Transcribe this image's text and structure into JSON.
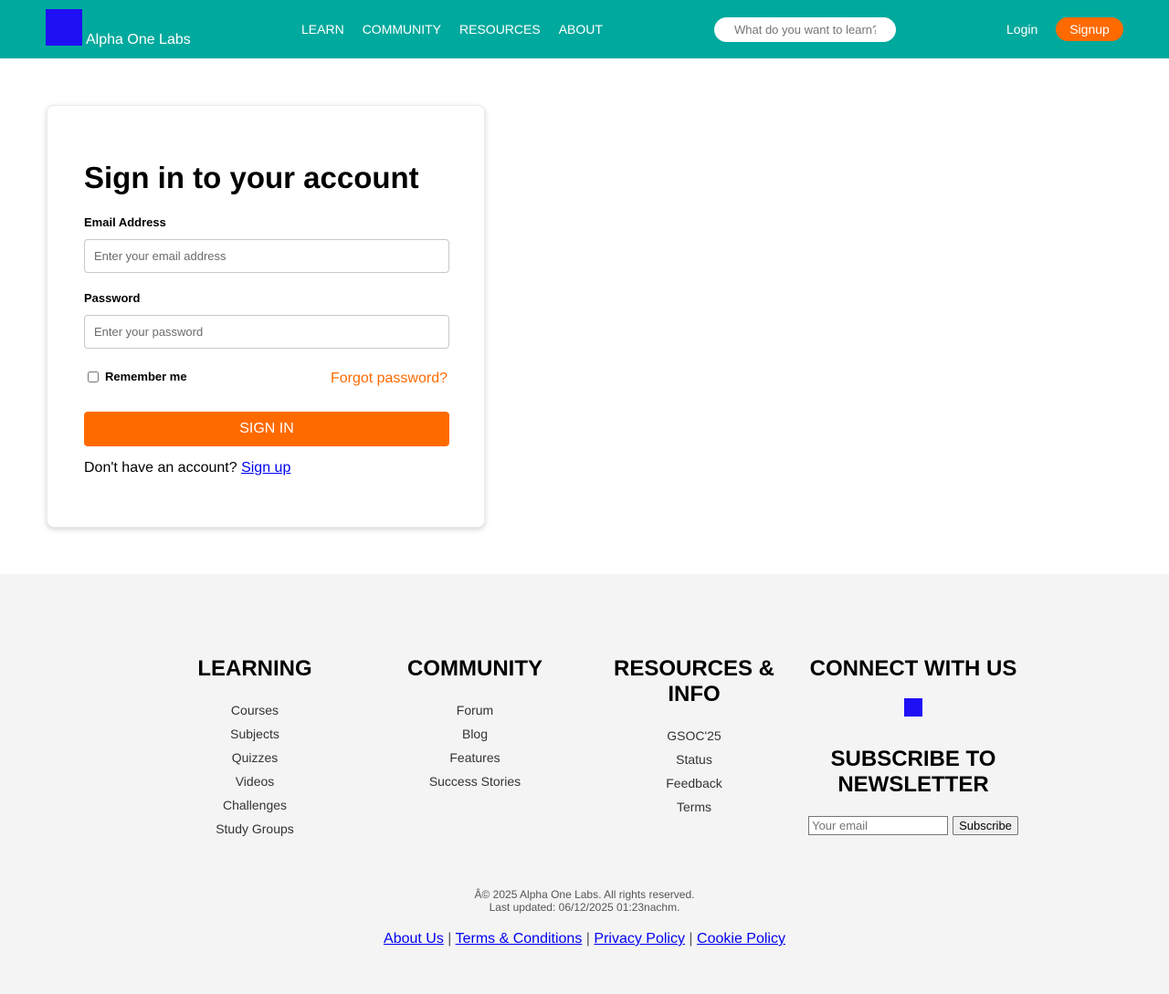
{
  "header": {
    "brand": "Alpha One Labs",
    "nav": [
      "LEARN",
      "COMMUNITY",
      "RESOURCES",
      "ABOUT"
    ],
    "search_placeholder": "What do you want to learn?",
    "login_label": "Login",
    "signup_label": "Signup",
    "colors": {
      "header_bg": "#00a99d",
      "accent": "#ff6a00",
      "logo": "#1f0ff5"
    }
  },
  "login_form": {
    "title": "Sign in to your account",
    "email_label": "Email Address",
    "email_placeholder": "Enter your email address",
    "password_label": "Password",
    "password_placeholder": "Enter your password",
    "remember_label": "Remember me",
    "forgot_label": "Forgot password?",
    "submit_label": "SIGN IN",
    "no_account_text": "Don't have an account?",
    "signup_link": "Sign up"
  },
  "footer": {
    "learning": {
      "title": "LEARNING",
      "items": [
        "Courses",
        "Subjects",
        "Quizzes",
        "Videos",
        "Challenges",
        "Study Groups"
      ]
    },
    "community": {
      "title": "COMMUNITY",
      "items": [
        "Forum",
        "Blog",
        "Features",
        "Success Stories"
      ]
    },
    "resources": {
      "title": "RESOURCES & INFO",
      "items": [
        "GSOC'25",
        "Status",
        "Feedback",
        "Terms"
      ]
    },
    "connect": {
      "title": "CONNECT WITH US",
      "social_icon": "social-icon",
      "newsletter_title": "SUBSCRIBE TO NEWSLETTER",
      "email_placeholder": "Your email",
      "subscribe_label": "Subscribe"
    },
    "copyright": "Â© 2025 Alpha One Labs. All rights reserved.",
    "last_updated": "Last updated: 06/12/2025 01:23nachm.",
    "bottom_links": [
      "About Us",
      "Terms & Conditions",
      "Privacy Policy",
      "Cookie Policy"
    ]
  }
}
